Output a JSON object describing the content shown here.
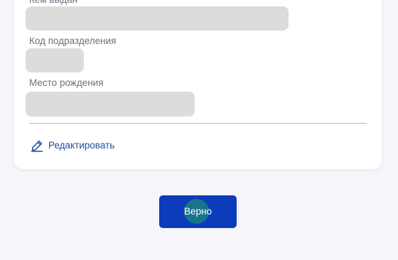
{
  "form": {
    "issued_by_label": "Кем выдан",
    "division_code_label": "Код подразделения",
    "birthplace_label": "Место рождения"
  },
  "actions": {
    "edit_label": "Редактировать",
    "edit_icon": "pencil-icon",
    "confirm_label": "Верно"
  },
  "colors": {
    "background": "#f4f6fa",
    "card": "#ffffff",
    "field_placeholder": "#dcdcdc",
    "link": "#1c4f9c",
    "primary_button": "#0c3cba",
    "ripple": "#1a7a86"
  }
}
